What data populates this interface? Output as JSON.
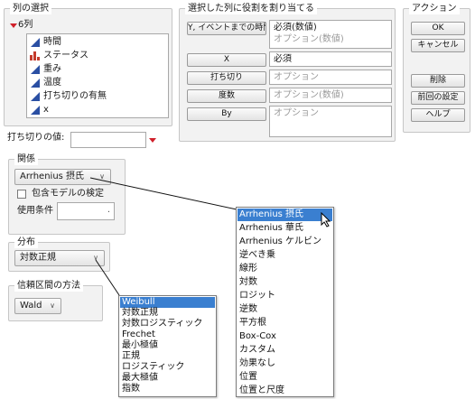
{
  "column_selection": {
    "title": "列の選択",
    "count_label": "6列",
    "columns": [
      {
        "label": "時間",
        "icon": "continuous-icon"
      },
      {
        "label": "ステータス",
        "icon": "nominal-icon"
      },
      {
        "label": "重み",
        "icon": "continuous-icon"
      },
      {
        "label": "温度",
        "icon": "continuous-icon"
      },
      {
        "label": "打ち切りの有無",
        "icon": "continuous-icon"
      },
      {
        "label": "x",
        "icon": "continuous-icon"
      }
    ]
  },
  "roles": {
    "title": "選択した列に役割を割り当てる",
    "items": [
      {
        "button": "Y, イベントまでの時間",
        "value": "必須(数値)",
        "placeholder": "オプション(数値)"
      },
      {
        "button": "X",
        "value": "必須",
        "placeholder": ""
      },
      {
        "button": "打ち切り",
        "value": "",
        "placeholder": "オプション"
      },
      {
        "button": "度数",
        "value": "",
        "placeholder": "オプション(数値)"
      },
      {
        "button": "By",
        "value": "",
        "placeholder": "オプション"
      }
    ]
  },
  "actions": {
    "title": "アクション",
    "ok": "OK",
    "cancel": "キャンセル",
    "remove": "削除",
    "recall": "前回の設定",
    "help": "ヘルプ"
  },
  "censor_code": {
    "label": "打ち切りの値:",
    "value": ""
  },
  "relationship": {
    "title": "関係",
    "selected": "Arrhenius 摂氏",
    "nested_checkbox_label": "包含モデルの検定",
    "nested_checked": false,
    "use_condition_label": "使用条件",
    "use_condition_value": ""
  },
  "distribution": {
    "title": "分布",
    "selected": "対数正規"
  },
  "confidence": {
    "title": "信頼区間の方法",
    "selected": "Wald"
  },
  "relationship_menu": {
    "selected_index": 0,
    "options": [
      "Arrhenius 摂氏",
      "Arrhenius 華氏",
      "Arrhenius ケルビン",
      "逆べき乗",
      "線形",
      "対数",
      "ロジット",
      "逆数",
      "平方根",
      "Box-Cox",
      "カスタム",
      "効果なし",
      "位置",
      "位置と尺度"
    ]
  },
  "distribution_menu": {
    "selected_index": 0,
    "options": [
      "Weibull",
      "対数正規",
      "対数ロジスティック",
      "Frechet",
      "最小極値",
      "正規",
      "ロジスティック",
      "最大極値",
      "指数"
    ]
  },
  "colors": {
    "accent": "#3a7fd0",
    "red_triangle": "#d0202a",
    "panel_bg": "#f2f2f2"
  }
}
